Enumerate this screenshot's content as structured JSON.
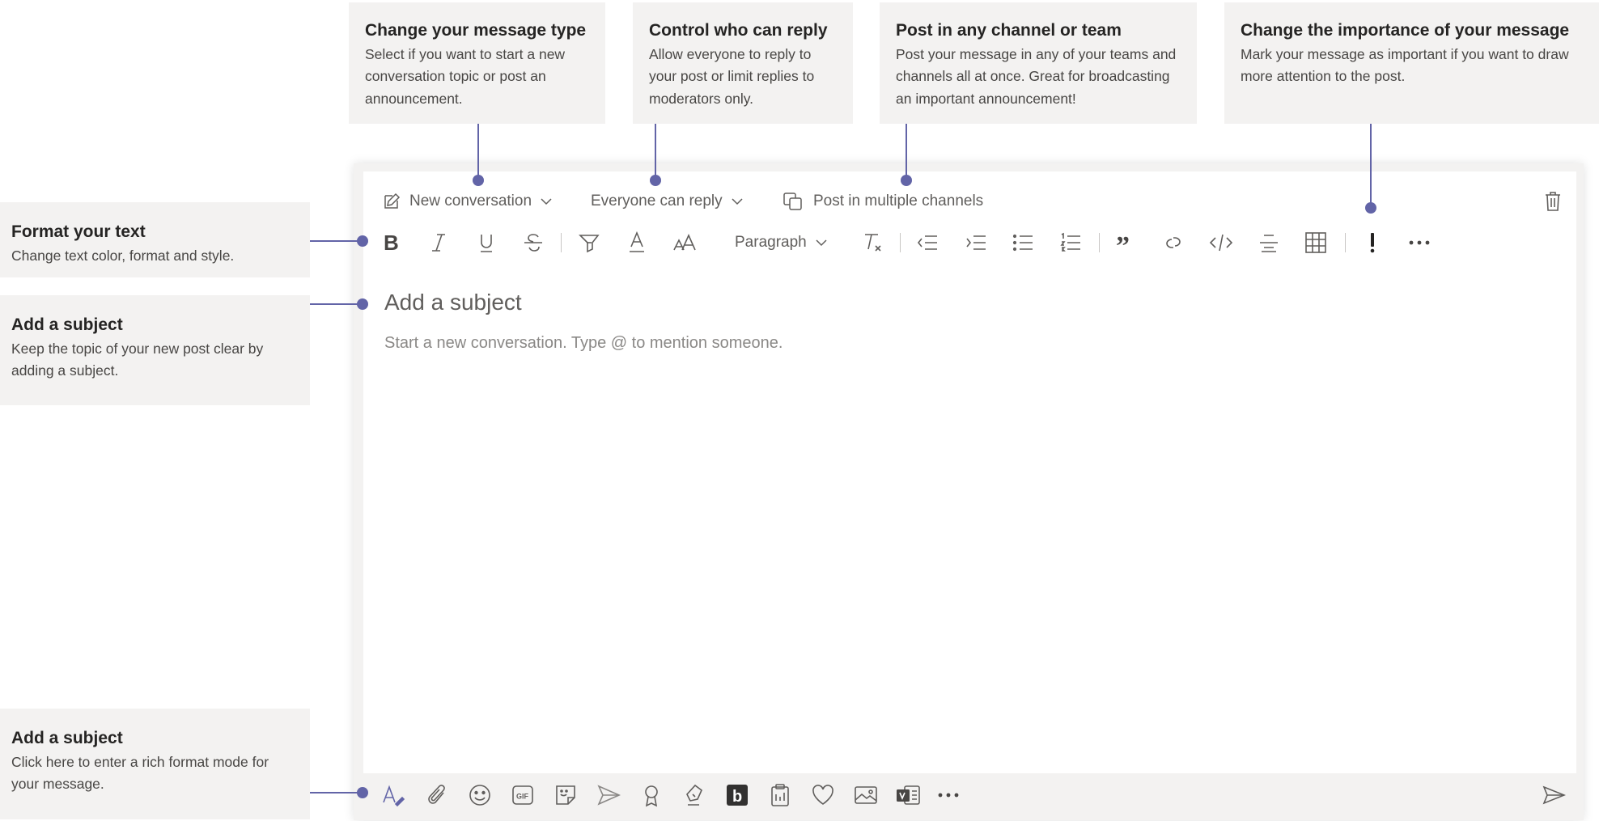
{
  "callouts": {
    "message_type": {
      "title": "Change your message type",
      "body": "Select if you want to start a new conversation topic or post an announcement."
    },
    "reply": {
      "title": "Control who can reply",
      "body": "Allow everyone to reply to your post or limit replies to moderators only."
    },
    "multi_channel": {
      "title": "Post in any channel or team",
      "body": "Post your message in any of your teams and channels all at once. Great for broadcasting an important announcement!"
    },
    "importance": {
      "title": "Change the importance of your message",
      "body": "Mark your message as important if you want to draw more attention to the post."
    },
    "format_text": {
      "title": "Format your text",
      "body": "Change text color, format and style."
    },
    "subject": {
      "title": "Add a subject",
      "body": "Keep the topic of your new post clear by adding a subject."
    },
    "rich_format": {
      "title": "Add a subject",
      "body": "Click here to enter a rich format mode for your message."
    }
  },
  "compose": {
    "message_type_label": "New conversation",
    "reply_label": "Everyone can reply",
    "multi_channel_label": "Post in multiple channels",
    "paragraph_label": "Paragraph",
    "subject_placeholder": "Add a subject",
    "body_placeholder": "Start a new conversation. Type @ to mention someone."
  },
  "format_toolbar_icons": [
    "bold-icon",
    "italic-icon",
    "underline-icon",
    "strikethrough-icon",
    "highlight-icon",
    "font-color-icon",
    "font-size-icon",
    "paragraph-dropdown",
    "clear-formatting-icon",
    "decrease-indent-icon",
    "increase-indent-icon",
    "bulleted-list-icon",
    "numbered-list-icon",
    "quote-icon",
    "link-icon",
    "code-snippet-icon",
    "horizontal-rule-icon",
    "table-icon",
    "mark-important-icon",
    "more-options-icon"
  ],
  "bottom_toolbar_icons": [
    "format-icon",
    "attach-icon",
    "emoji-icon",
    "gif-icon",
    "sticker-icon",
    "meet-now-icon",
    "praise-icon",
    "approvals-icon",
    "bookings-icon",
    "forms-icon",
    "heart-icon",
    "image-icon",
    "stream-icon",
    "more-apps-icon",
    "send-icon"
  ],
  "colors": {
    "accent": "#6264a7",
    "callout_bg": "#f3f2f1",
    "text": "#252423",
    "muted": "#605e5c"
  }
}
